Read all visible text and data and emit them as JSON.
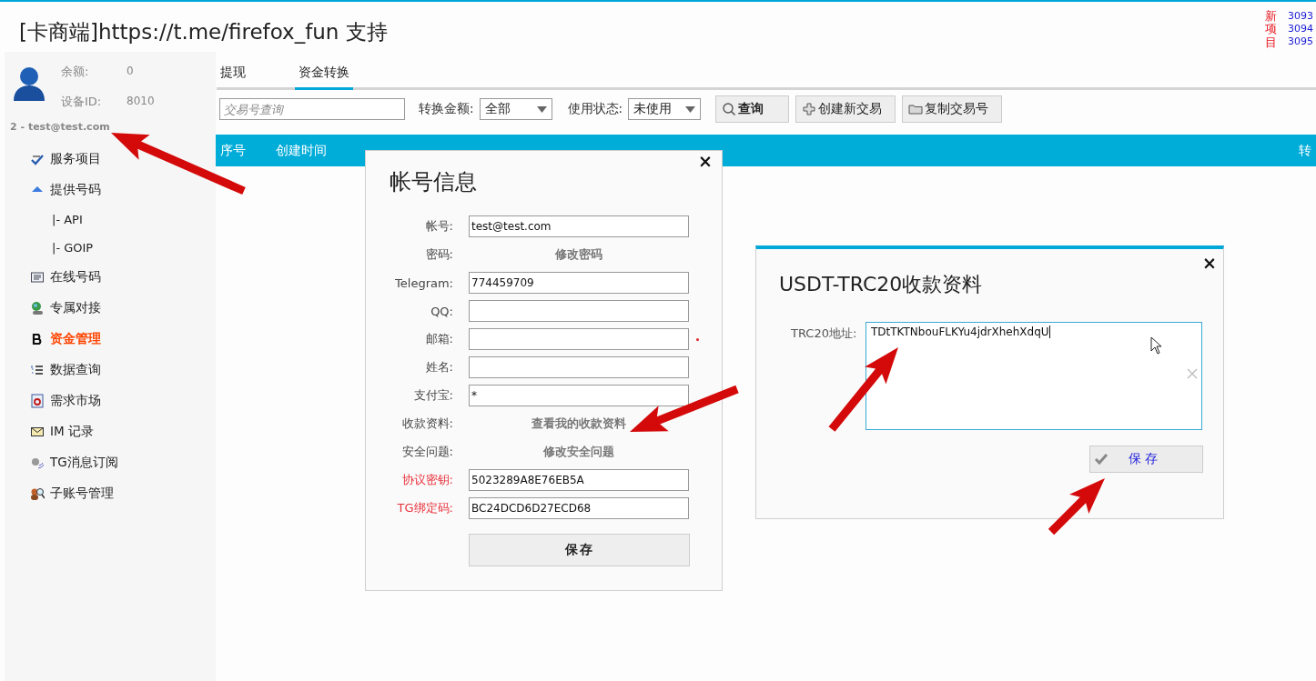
{
  "header": {
    "title": "[卡商端]https://t.me/firefox_fun 支持",
    "notice_label": "新项目",
    "notice_numbers": [
      "3093",
      "3094",
      "3095"
    ]
  },
  "sidebar": {
    "balance_label": "余额:",
    "balance": "0",
    "device_label": "设备ID:",
    "device": "8010",
    "account": "2 - test@test.com",
    "items": [
      {
        "label": "服务项目",
        "kind": "abc",
        "selected": false
      },
      {
        "label": "提供号码",
        "kind": "up",
        "selected": false,
        "children": [
          {
            "label": "|-  API",
            "selected": false
          },
          {
            "label": "|-  GOIP",
            "selected": false
          }
        ]
      },
      {
        "label": "在线号码",
        "kind": "list",
        "selected": false
      },
      {
        "label": "专属对接",
        "kind": "globe",
        "selected": false
      },
      {
        "label": "资金管理",
        "kind": "bold",
        "selected": true
      },
      {
        "label": "数据查询",
        "kind": "numlist",
        "selected": false
      },
      {
        "label": "需求市场",
        "kind": "doc",
        "selected": false
      },
      {
        "label": "IM 记录",
        "kind": "mail",
        "selected": false
      },
      {
        "label": "TG消息订阅",
        "kind": "speaker",
        "selected": false
      },
      {
        "label": "子账号管理",
        "kind": "users",
        "selected": false
      }
    ]
  },
  "tabs": [
    {
      "label": "提现",
      "selected": false
    },
    {
      "label": "资金转换",
      "selected": true
    }
  ],
  "toolbar": {
    "search": {
      "placeholder": "交易号查询"
    },
    "amount_label": "转换金额:",
    "amount": "全部",
    "status_label": "使用状态:",
    "status": "未使用",
    "buttons": [
      {
        "label": "查询",
        "kind": "search"
      },
      {
        "label": "创建新交易",
        "kind": "plus"
      },
      {
        "label": "复制交易号",
        "kind": "folder"
      }
    ]
  },
  "table": {
    "columns": [
      "序号",
      "创建时间",
      "转"
    ]
  },
  "account_dialog": {
    "title": "帐号信息",
    "close": "×",
    "rows": [
      {
        "label": "帐号:",
        "kind": "input",
        "value": "test@test.com",
        "required": false,
        "highlight": false
      },
      {
        "label": "密码:",
        "kind": "link",
        "value": "修改密码",
        "required": false,
        "highlight": false
      },
      {
        "label": "Telegram:",
        "kind": "input",
        "value": "774459709",
        "required": false,
        "highlight": false
      },
      {
        "label": "QQ:",
        "kind": "input",
        "required": false,
        "highlight": false
      },
      {
        "label": "邮箱:",
        "kind": "input",
        "required": true,
        "highlight": false
      },
      {
        "label": "姓名:",
        "kind": "input",
        "required": false,
        "highlight": false
      },
      {
        "label": "支付宝:",
        "kind": "input",
        "value": "*",
        "required": false,
        "highlight": false
      },
      {
        "label": "收款资料:",
        "kind": "link",
        "value": "查看我的收款资料",
        "required": false,
        "highlight": false
      },
      {
        "label": "安全问题:",
        "kind": "link",
        "value": "修改安全问题",
        "required": false,
        "highlight": false
      },
      {
        "label": "协议密钥:",
        "kind": "input",
        "value": "5023289A8E76EB5A",
        "required": false,
        "highlight": true
      },
      {
        "label": "TG绑定码:",
        "kind": "input",
        "value": "BC24DCD6D27ECD68",
        "required": false,
        "highlight": true
      }
    ],
    "save": "保存"
  },
  "usdt_dialog": {
    "title": "USDT-TRC20收款资料",
    "close": "×",
    "address_label": "TRC20地址:",
    "address": "TDtTKTNbouFLKYu4jdrXhehXdqU",
    "save": "保 存"
  }
}
